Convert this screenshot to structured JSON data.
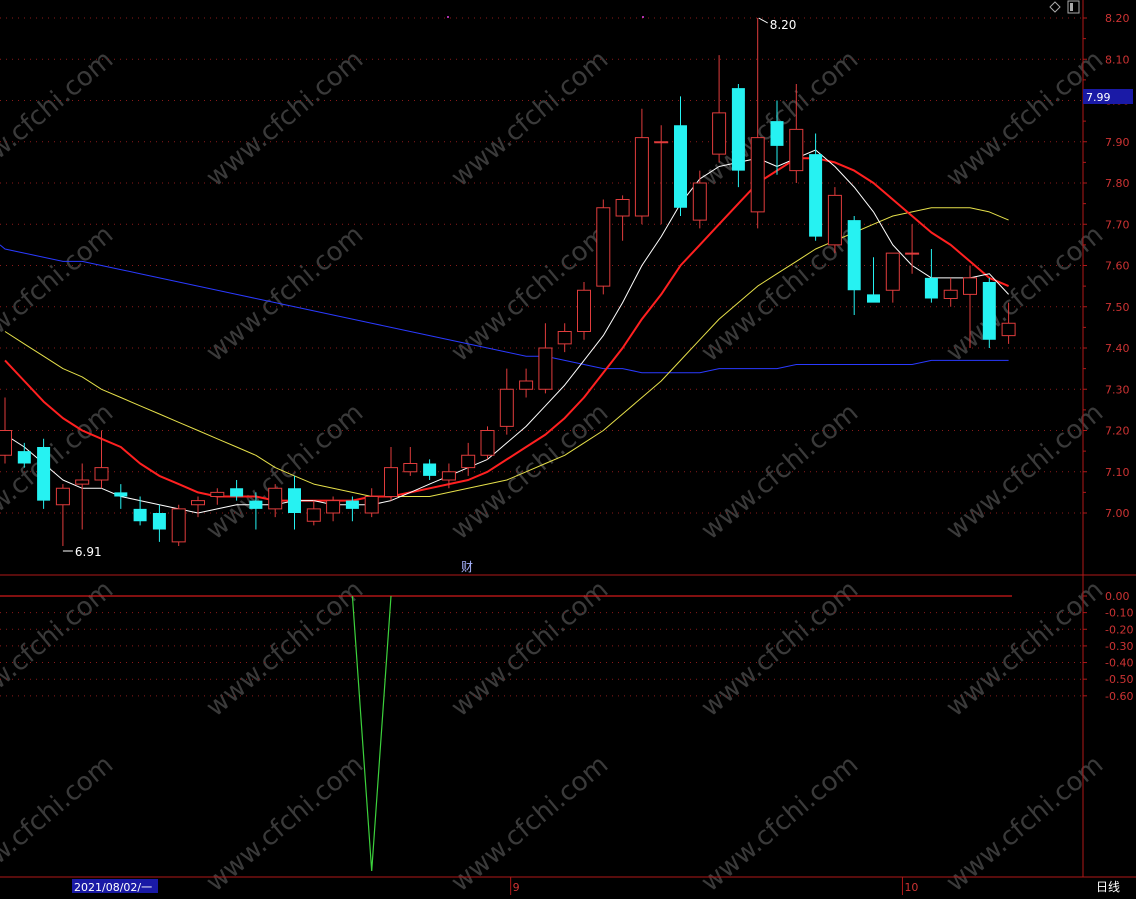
{
  "window": {
    "period_label": "日线",
    "date_box": "2021/08/02/一",
    "finance_marker": "财"
  },
  "colors": {
    "background": "#000000",
    "up": "#e03c3c",
    "down": "#26f2f2",
    "ma5": "#ffffff",
    "ma10": "#ff2020",
    "ma20": "#e6e04a",
    "ma60": "#2a3aff",
    "axis": "#b01818",
    "grid": "#8a1a1a",
    "axis_text": "#cc3333",
    "last_price_bg": "#1a1aa6",
    "indicator": "#3cd23c",
    "watermark": "#3a3a3a",
    "pink_dot": "#e040e0"
  },
  "watermark_text": "www.cfchi.com",
  "chart_data": [
    {
      "type": "candlestick",
      "y_ticks": [
        "8.20",
        "8.10",
        "8.00",
        "7.90",
        "7.80",
        "7.70",
        "7.60",
        "7.50",
        "7.40",
        "7.30",
        "7.20",
        "7.10",
        "7.00"
      ],
      "ylim": [
        6.88,
        8.22
      ],
      "last_price": "7.99",
      "high_label": "8.20",
      "low_label": "6.91",
      "x_labels": [
        "9",
        "10"
      ],
      "candles": [
        {
          "o": 7.14,
          "h": 7.28,
          "l": 7.12,
          "c": 7.2
        },
        {
          "o": 7.15,
          "h": 7.17,
          "l": 7.11,
          "c": 7.12
        },
        {
          "o": 7.16,
          "h": 7.18,
          "l": 7.01,
          "c": 7.03
        },
        {
          "o": 7.02,
          "h": 7.07,
          "l": 6.92,
          "c": 7.06
        },
        {
          "o": 7.07,
          "h": 7.12,
          "l": 6.96,
          "c": 7.08
        },
        {
          "o": 7.08,
          "h": 7.2,
          "l": 7.06,
          "c": 7.11
        },
        {
          "o": 7.05,
          "h": 7.07,
          "l": 7.01,
          "c": 7.04
        },
        {
          "o": 7.01,
          "h": 7.04,
          "l": 6.97,
          "c": 6.98
        },
        {
          "o": 7.0,
          "h": 7.02,
          "l": 6.93,
          "c": 6.96
        },
        {
          "o": 6.93,
          "h": 7.02,
          "l": 6.92,
          "c": 7.01
        },
        {
          "o": 7.02,
          "h": 7.04,
          "l": 6.99,
          "c": 7.03
        },
        {
          "o": 7.04,
          "h": 7.06,
          "l": 7.02,
          "c": 7.05
        },
        {
          "o": 7.06,
          "h": 7.08,
          "l": 7.03,
          "c": 7.04
        },
        {
          "o": 7.03,
          "h": 7.05,
          "l": 6.96,
          "c": 7.01
        },
        {
          "o": 7.01,
          "h": 7.07,
          "l": 6.99,
          "c": 7.06
        },
        {
          "o": 7.06,
          "h": 7.09,
          "l": 6.96,
          "c": 7.0
        },
        {
          "o": 6.98,
          "h": 7.03,
          "l": 6.97,
          "c": 7.01
        },
        {
          "o": 7.0,
          "h": 7.04,
          "l": 6.98,
          "c": 7.03
        },
        {
          "o": 7.03,
          "h": 7.04,
          "l": 6.98,
          "c": 7.01
        },
        {
          "o": 7.0,
          "h": 7.06,
          "l": 6.99,
          "c": 7.04
        },
        {
          "o": 7.04,
          "h": 7.16,
          "l": 7.03,
          "c": 7.11
        },
        {
          "o": 7.1,
          "h": 7.16,
          "l": 7.09,
          "c": 7.12
        },
        {
          "o": 7.12,
          "h": 7.13,
          "l": 7.08,
          "c": 7.09
        },
        {
          "o": 7.08,
          "h": 7.12,
          "l": 7.06,
          "c": 7.1
        },
        {
          "o": 7.11,
          "h": 7.17,
          "l": 7.09,
          "c": 7.14
        },
        {
          "o": 7.14,
          "h": 7.21,
          "l": 7.13,
          "c": 7.2
        },
        {
          "o": 7.21,
          "h": 7.35,
          "l": 7.19,
          "c": 7.3
        },
        {
          "o": 7.3,
          "h": 7.35,
          "l": 7.28,
          "c": 7.32
        },
        {
          "o": 7.3,
          "h": 7.46,
          "l": 7.29,
          "c": 7.4
        },
        {
          "o": 7.41,
          "h": 7.46,
          "l": 7.39,
          "c": 7.44
        },
        {
          "o": 7.44,
          "h": 7.56,
          "l": 7.42,
          "c": 7.54
        },
        {
          "o": 7.55,
          "h": 7.76,
          "l": 7.53,
          "c": 7.74
        },
        {
          "o": 7.72,
          "h": 7.77,
          "l": 7.66,
          "c": 7.76
        },
        {
          "o": 7.72,
          "h": 7.98,
          "l": 7.7,
          "c": 7.91
        },
        {
          "o": 7.9,
          "h": 7.94,
          "l": 7.7,
          "c": 7.9
        },
        {
          "o": 7.94,
          "h": 8.01,
          "l": 7.72,
          "c": 7.74
        },
        {
          "o": 7.71,
          "h": 7.83,
          "l": 7.69,
          "c": 7.8
        },
        {
          "o": 7.87,
          "h": 8.11,
          "l": 7.85,
          "c": 7.97
        },
        {
          "o": 8.03,
          "h": 8.04,
          "l": 7.79,
          "c": 7.83
        },
        {
          "o": 7.73,
          "h": 8.2,
          "l": 7.69,
          "c": 7.91
        },
        {
          "o": 7.95,
          "h": 8.0,
          "l": 7.82,
          "c": 7.89
        },
        {
          "o": 7.83,
          "h": 8.04,
          "l": 7.8,
          "c": 7.93
        },
        {
          "o": 7.87,
          "h": 7.92,
          "l": 7.66,
          "c": 7.67
        },
        {
          "o": 7.65,
          "h": 7.79,
          "l": 7.63,
          "c": 7.77
        },
        {
          "o": 7.71,
          "h": 7.72,
          "l": 7.48,
          "c": 7.54
        },
        {
          "o": 7.53,
          "h": 7.62,
          "l": 7.52,
          "c": 7.51
        },
        {
          "o": 7.54,
          "h": 7.62,
          "l": 7.51,
          "c": 7.63
        },
        {
          "o": 7.63,
          "h": 7.7,
          "l": 7.58,
          "c": 7.63
        },
        {
          "o": 7.57,
          "h": 7.64,
          "l": 7.51,
          "c": 7.52
        },
        {
          "o": 7.52,
          "h": 7.57,
          "l": 7.5,
          "c": 7.54
        },
        {
          "o": 7.53,
          "h": 7.6,
          "l": 7.4,
          "c": 7.57
        },
        {
          "o": 7.56,
          "h": 7.57,
          "l": 7.4,
          "c": 7.42
        },
        {
          "o": 7.43,
          "h": 7.51,
          "l": 7.41,
          "c": 7.46
        }
      ],
      "ma5": [
        7.19,
        7.16,
        7.12,
        7.08,
        7.06,
        7.06,
        7.04,
        7.03,
        7.02,
        7.01,
        7.0,
        7.01,
        7.02,
        7.02,
        7.02,
        7.03,
        7.03,
        7.02,
        7.02,
        7.02,
        7.03,
        7.05,
        7.07,
        7.09,
        7.11,
        7.13,
        7.17,
        7.21,
        7.26,
        7.31,
        7.37,
        7.43,
        7.51,
        7.6,
        7.67,
        7.75,
        7.81,
        7.84,
        7.85,
        7.86,
        7.84,
        7.86,
        7.88,
        7.84,
        7.79,
        7.73,
        7.65,
        7.6,
        7.57,
        7.57,
        7.57,
        7.58,
        7.53
      ],
      "ma10": [
        7.37,
        7.32,
        7.27,
        7.23,
        7.2,
        7.18,
        7.16,
        7.12,
        7.09,
        7.07,
        7.05,
        7.04,
        7.04,
        7.04,
        7.03,
        7.03,
        7.03,
        7.03,
        7.03,
        7.04,
        7.04,
        7.05,
        7.06,
        7.07,
        7.08,
        7.1,
        7.13,
        7.16,
        7.19,
        7.23,
        7.28,
        7.34,
        7.4,
        7.47,
        7.53,
        7.6,
        7.65,
        7.7,
        7.75,
        7.8,
        7.83,
        7.86,
        7.86,
        7.85,
        7.83,
        7.8,
        7.76,
        7.72,
        7.68,
        7.65,
        7.61,
        7.57,
        7.55
      ],
      "ma20": [
        7.44,
        7.41,
        7.38,
        7.35,
        7.33,
        7.3,
        7.28,
        7.26,
        7.24,
        7.22,
        7.2,
        7.18,
        7.16,
        7.14,
        7.11,
        7.09,
        7.07,
        7.06,
        7.05,
        7.04,
        7.04,
        7.04,
        7.04,
        7.05,
        7.06,
        7.07,
        7.08,
        7.1,
        7.12,
        7.14,
        7.17,
        7.2,
        7.24,
        7.28,
        7.32,
        7.37,
        7.42,
        7.47,
        7.51,
        7.55,
        7.58,
        7.61,
        7.64,
        7.66,
        7.68,
        7.7,
        7.72,
        7.73,
        7.74,
        7.74,
        7.74,
        7.73,
        7.71
      ],
      "ma60": [
        7.64,
        7.63,
        7.62,
        7.61,
        7.61,
        7.6,
        7.59,
        7.58,
        7.57,
        7.56,
        7.55,
        7.54,
        7.53,
        7.52,
        7.51,
        7.5,
        7.49,
        7.48,
        7.47,
        7.46,
        7.45,
        7.44,
        7.43,
        7.42,
        7.41,
        7.4,
        7.39,
        7.38,
        7.38,
        7.37,
        7.36,
        7.35,
        7.35,
        7.34,
        7.34,
        7.34,
        7.34,
        7.35,
        7.35,
        7.35,
        7.35,
        7.36,
        7.36,
        7.36,
        7.36,
        7.36,
        7.36,
        7.36,
        7.37,
        7.37,
        7.37,
        7.37,
        7.37
      ]
    },
    {
      "type": "line",
      "y_ticks": [
        "0.00",
        "-0.10",
        "-0.20",
        "-0.30",
        "-0.40",
        "-0.50",
        "-0.60"
      ],
      "ylim": [
        -1.0,
        0.0
      ],
      "series": [
        {
          "x": [
            18,
            19,
            20
          ],
          "y": [
            0.0,
            -1.0,
            0.0
          ]
        }
      ],
      "zero_line_label": "0.00"
    }
  ]
}
